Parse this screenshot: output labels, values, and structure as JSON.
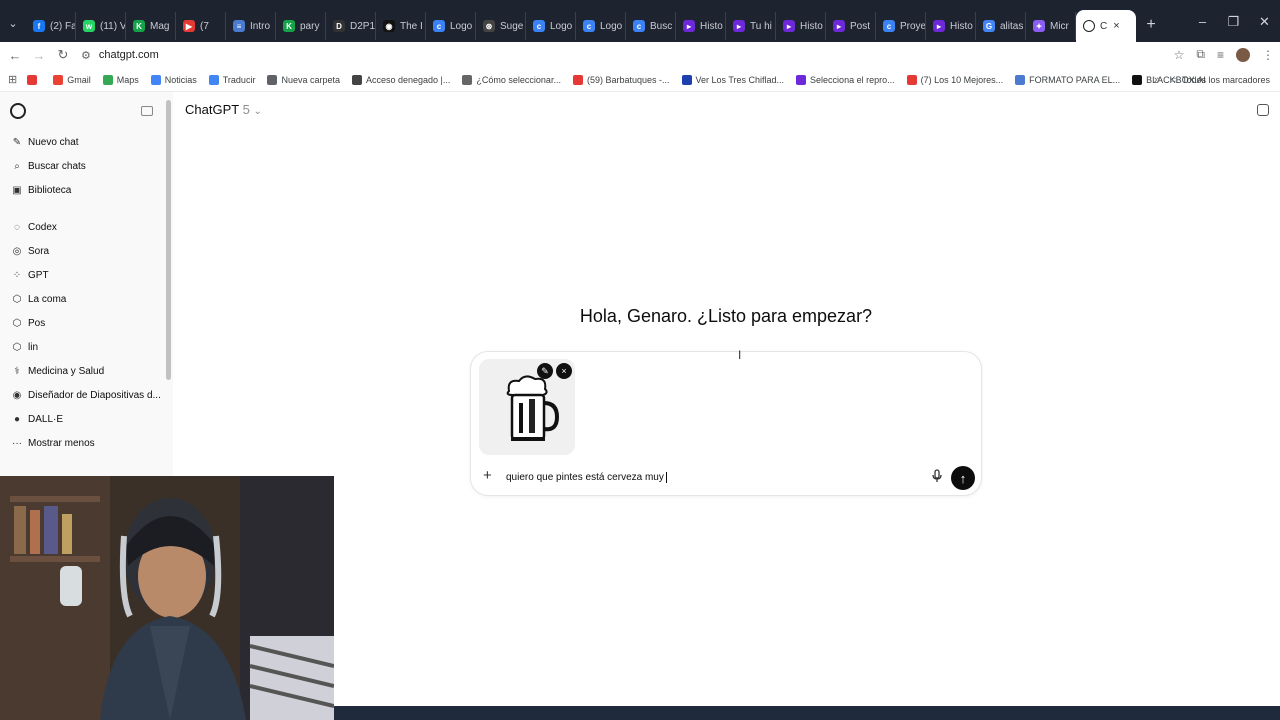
{
  "browser": {
    "tabs": [
      {
        "label": "(2) Fa",
        "color": "#1877f2",
        "glyph": "f"
      },
      {
        "label": "(11) V",
        "color": "#25d366",
        "glyph": "w"
      },
      {
        "label": "Mag",
        "color": "#15a34a",
        "glyph": "K"
      },
      {
        "label": "(7",
        "color": "#e53935",
        "glyph": "▶"
      },
      {
        "label": "Intro",
        "color": "#4a7bd0",
        "glyph": "≡"
      },
      {
        "label": "pary",
        "color": "#15a34a",
        "glyph": "K"
      },
      {
        "label": "D2P1",
        "color": "#333333",
        "glyph": "D"
      },
      {
        "label": "The I",
        "color": "#111111",
        "glyph": "◉"
      },
      {
        "label": "Logo",
        "color": "#3b82f6",
        "glyph": "c"
      },
      {
        "label": "Suge",
        "color": "#444444",
        "glyph": "⊛"
      },
      {
        "label": "Logo",
        "color": "#3b82f6",
        "glyph": "c"
      },
      {
        "label": "Logo",
        "color": "#3b82f6",
        "glyph": "c"
      },
      {
        "label": "Busc",
        "color": "#3b82f6",
        "glyph": "c"
      },
      {
        "label": "Histo",
        "color": "#6d28d9",
        "glyph": "▸"
      },
      {
        "label": "Tu hi",
        "color": "#6d28d9",
        "glyph": "▸"
      },
      {
        "label": "Histo",
        "color": "#6d28d9",
        "glyph": "▸"
      },
      {
        "label": "Post",
        "color": "#6d28d9",
        "glyph": "▸"
      },
      {
        "label": "Proye",
        "color": "#3b82f6",
        "glyph": "c"
      },
      {
        "label": "Histo",
        "color": "#6d28d9",
        "glyph": "▸"
      },
      {
        "label": "alitas",
        "color": "#4285f4",
        "glyph": "G"
      },
      {
        "label": "Micr",
        "color": "#8b5cf6",
        "glyph": "✦"
      }
    ],
    "active_tab": {
      "label": "C",
      "close": "×"
    },
    "new_tab": "+",
    "window_controls": [
      "–",
      "❐",
      "✕"
    ],
    "url": "chatgpt.com",
    "bookmarks": [
      {
        "label": "",
        "color": "#e53935"
      },
      {
        "label": "Gmail",
        "color": "#ea4335"
      },
      {
        "label": "Maps",
        "color": "#34a853"
      },
      {
        "label": "Noticias",
        "color": "#4285f4"
      },
      {
        "label": "Traducir",
        "color": "#4285f4"
      },
      {
        "label": "Nueva carpeta",
        "color": "#5f6368"
      },
      {
        "label": "Acceso denegado |...",
        "color": "#444444"
      },
      {
        "label": "¿Cómo seleccionar...",
        "color": "#666666"
      },
      {
        "label": "(59) Barbatuques -...",
        "color": "#e53935"
      },
      {
        "label": "Ver Los Tres Chiflad...",
        "color": "#1e40af"
      },
      {
        "label": "Selecciona el repro...",
        "color": "#6d28d9"
      },
      {
        "label": "(7) Los 10 Mejores...",
        "color": "#e53935"
      },
      {
        "label": "FORMATO PARA EL...",
        "color": "#4a7bd0"
      },
      {
        "label": "BLACKBOX.AI",
        "color": "#111111"
      }
    ],
    "bookmarks_more": "»",
    "all_bookmarks": "Todos los marcadores"
  },
  "sidebar": {
    "primary": [
      {
        "label": "Nuevo chat",
        "icon": "✎"
      },
      {
        "label": "Buscar chats",
        "icon": "⌕"
      },
      {
        "label": "Biblioteca",
        "icon": "▣"
      }
    ],
    "secondary": [
      {
        "label": "Codex",
        "icon": "◌"
      },
      {
        "label": "Sora",
        "icon": "◎"
      },
      {
        "label": "GPT",
        "icon": "⁘"
      },
      {
        "label": "La coma",
        "icon": "⬡"
      },
      {
        "label": "Pos",
        "icon": "⬡"
      },
      {
        "label": "lin",
        "icon": "⬡"
      },
      {
        "label": "Medicina y Salud",
        "icon": "⚕"
      },
      {
        "label": "Diseñador de Diapositivas d...",
        "icon": "◉"
      },
      {
        "label": "DALL·E",
        "icon": "●"
      },
      {
        "label": "Mostrar menos",
        "icon": "···"
      }
    ]
  },
  "header": {
    "model": "ChatGPT",
    "version": "5",
    "chevron": "⌄"
  },
  "greeting": "Hola, Genaro. ¿Listo para empezar?",
  "composer": {
    "text": "quiero que pintes está cerveza muy",
    "plus": "+",
    "mic": "🎙",
    "send": "↑",
    "attachment": {
      "edit": "✎",
      "remove": "×"
    }
  }
}
